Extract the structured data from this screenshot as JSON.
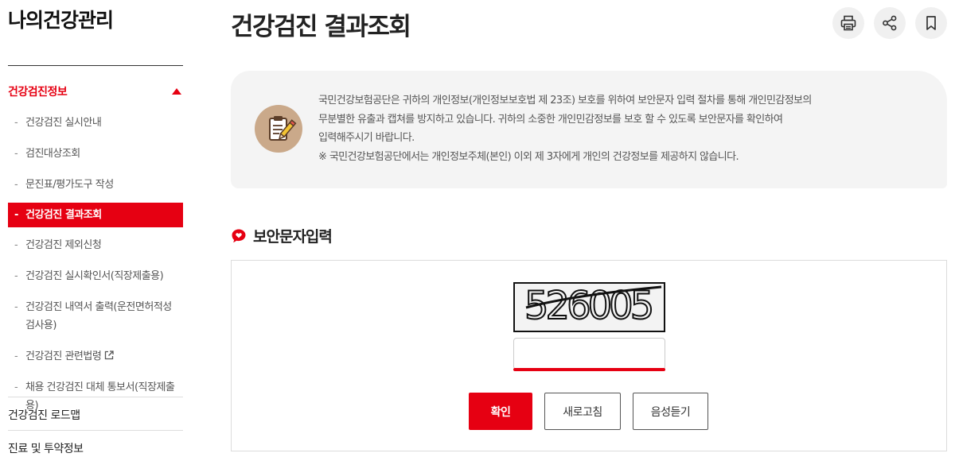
{
  "sidebar": {
    "title": "나의건강관리",
    "section_label": "건강검진정보",
    "items": [
      {
        "label": "건강검진 실시안내"
      },
      {
        "label": "검진대상조회"
      },
      {
        "label": "문진표/평가도구 작성"
      },
      {
        "label": "건강검진 결과조회",
        "active": true
      },
      {
        "label": "건강검진 제외신청"
      },
      {
        "label": "건강검진 실시확인서(직장제출용)"
      },
      {
        "label": "건강검진 내역서 출력(운전면허적성검사용)"
      },
      {
        "label": "건강검진 관련법령"
      },
      {
        "label": "채용 건강검진 대체 통보서(직장제출용)"
      }
    ],
    "dash": "-",
    "links": [
      {
        "label": "건강검진 로드맵"
      },
      {
        "label": "진료 및 투약정보"
      }
    ]
  },
  "header": {
    "title": "건강검진 결과조회",
    "tools": [
      "printer-icon",
      "share-icon",
      "bookmark-icon"
    ]
  },
  "notice": {
    "icon": "clipboard-pencil-icon",
    "lines": [
      "국민건강보험공단은 귀하의 개인정보(개인정보보호법 제 23조) 보호를 위하여 보안문자 입력 절차를 통해 개인민감정보의",
      "무분별한 유출과 캡쳐를 방지하고 있습니다. 귀하의 소중한 개인민감정보를 보호 할 수 있도록 보안문자를 확인하여",
      "입력해주시기 바랍니다.",
      "※ 국민건강보험공단에서는 개인정보주체(본인) 이외 제 3자에게 개인의 건강정보를 제공하지 않습니다."
    ]
  },
  "security": {
    "heading": "보안문자입력",
    "heading_icon": "speech-heart-icon",
    "captcha_text": "526005",
    "input_value": "",
    "buttons": {
      "confirm": "확인",
      "refresh": "새로고침",
      "audio": "음성듣기"
    }
  },
  "colors": {
    "accent": "#e60012",
    "notice_bg": "#f4f4f4",
    "icon_circle": "#caa98a"
  }
}
